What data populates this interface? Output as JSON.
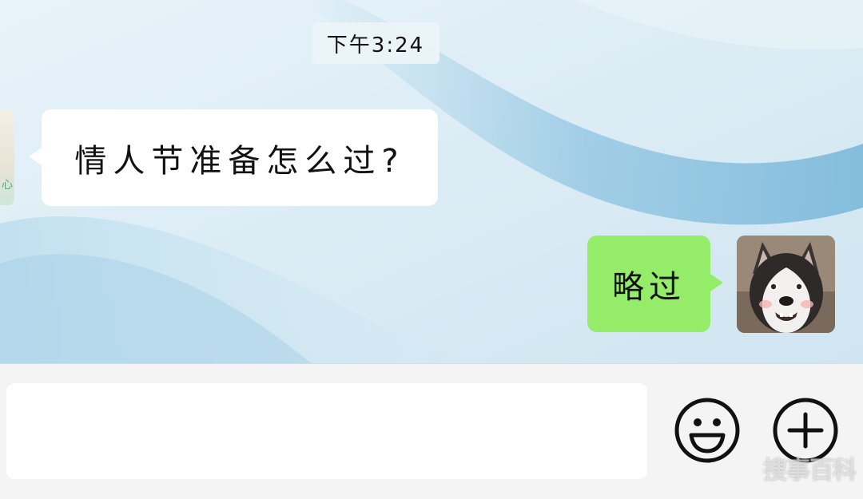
{
  "chat": {
    "timestamp": "下午3:24",
    "messages": [
      {
        "side": "incoming",
        "text": "情人节准备怎么过?"
      },
      {
        "side": "outgoing",
        "text": "略过"
      }
    ],
    "left_avatar_glyph": "心"
  },
  "input_bar": {
    "message_value": "",
    "message_placeholder": "",
    "emoji_icon": "smiley-face-icon",
    "plus_icon": "plus-circle-icon"
  },
  "watermark": {
    "text": "搜事百科"
  },
  "colors": {
    "outgoing_bubble": "#95ec69",
    "incoming_bubble": "#ffffff",
    "input_bar_bg": "#f4f4f4",
    "wallpaper_base": "#dcedf6"
  }
}
